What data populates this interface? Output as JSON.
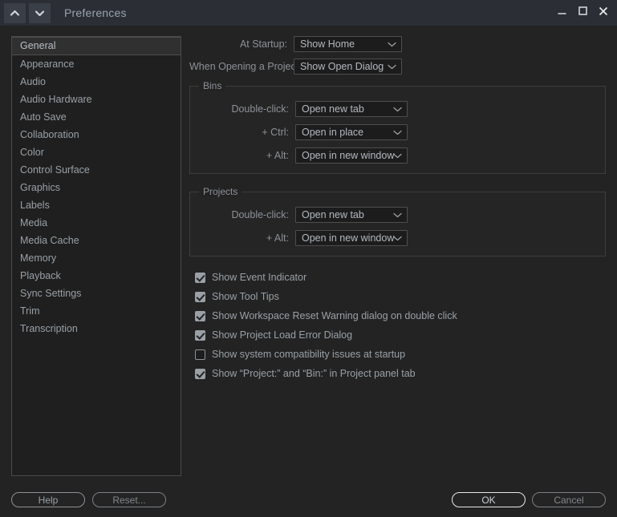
{
  "window": {
    "title": "Preferences",
    "nav_prev_icon": "chevron-up-icon",
    "nav_next_icon": "chevron-down-icon",
    "minimize_icon": "minimize-icon",
    "maximize_icon": "maximize-icon",
    "close_icon": "close-icon",
    "background": "#232323",
    "titlebar_background": "#2b2f35"
  },
  "sidebar": {
    "selected": "General",
    "items": [
      {
        "label": "General"
      },
      {
        "label": "Appearance"
      },
      {
        "label": "Audio"
      },
      {
        "label": "Audio Hardware"
      },
      {
        "label": "Auto Save"
      },
      {
        "label": "Collaboration"
      },
      {
        "label": "Color"
      },
      {
        "label": "Control Surface"
      },
      {
        "label": "Graphics"
      },
      {
        "label": "Labels"
      },
      {
        "label": "Media"
      },
      {
        "label": "Media Cache"
      },
      {
        "label": "Memory"
      },
      {
        "label": "Playback"
      },
      {
        "label": "Sync Settings"
      },
      {
        "label": "Trim"
      },
      {
        "label": "Transcription"
      }
    ]
  },
  "main": {
    "startup": {
      "label": "At Startup:",
      "value": "Show Home"
    },
    "opening_project": {
      "label": "When Opening a Project:",
      "value": "Show Open Dialog"
    },
    "bins": {
      "legend": "Bins",
      "rows": [
        {
          "label": "Double-click:",
          "value": "Open new tab"
        },
        {
          "label": "+ Ctrl:",
          "value": "Open in place"
        },
        {
          "label": "+ Alt:",
          "value": "Open in new window"
        }
      ]
    },
    "projects": {
      "legend": "Projects",
      "rows": [
        {
          "label": "Double-click:",
          "value": "Open new tab"
        },
        {
          "label": "+ Alt:",
          "value": "Open in new window"
        }
      ]
    },
    "checkboxes": [
      {
        "label": "Show Event Indicator",
        "checked": true
      },
      {
        "label": "Show Tool Tips",
        "checked": true
      },
      {
        "label": "Show Workspace Reset Warning dialog on double click",
        "checked": true
      },
      {
        "label": "Show Project Load Error Dialog",
        "checked": true
      },
      {
        "label": "Show system compatibility issues at startup",
        "checked": false
      },
      {
        "label": "Show “Project:” and “Bin:” in Project panel tab",
        "checked": true
      }
    ]
  },
  "footer": {
    "help": "Help",
    "reset": "Reset...",
    "ok": "OK",
    "cancel": "Cancel"
  }
}
